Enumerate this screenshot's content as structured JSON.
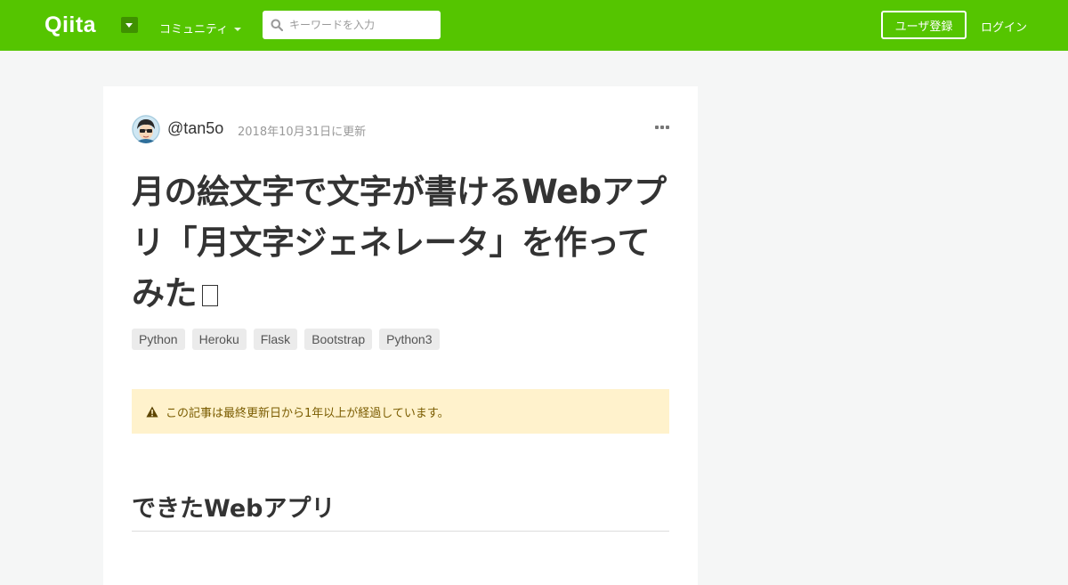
{
  "header": {
    "logo": "Qiita",
    "community_label": "コミュニティ",
    "search_placeholder": "キーワードを入力",
    "signup_label": "ユーザ登録",
    "login_label": "ログイン",
    "brand_color": "#55c500"
  },
  "article": {
    "author": "@tan5o",
    "updated": "2018年10月31日に更新",
    "title": "月の絵文字で文字が書けるWebアプリ「月文字ジェネレータ」を作ってみた",
    "tags": [
      "Python",
      "Heroku",
      "Flask",
      "Bootstrap",
      "Python3"
    ],
    "alert": "この記事は最終更新日から1年以上が経過しています。",
    "section_heading": "できたWebアプリ",
    "alert_color": "#fff2cc"
  },
  "icons": {
    "search": "search-icon",
    "more": "more-icon",
    "warning": "warning-icon",
    "dropdown": "chevron-down-icon"
  }
}
